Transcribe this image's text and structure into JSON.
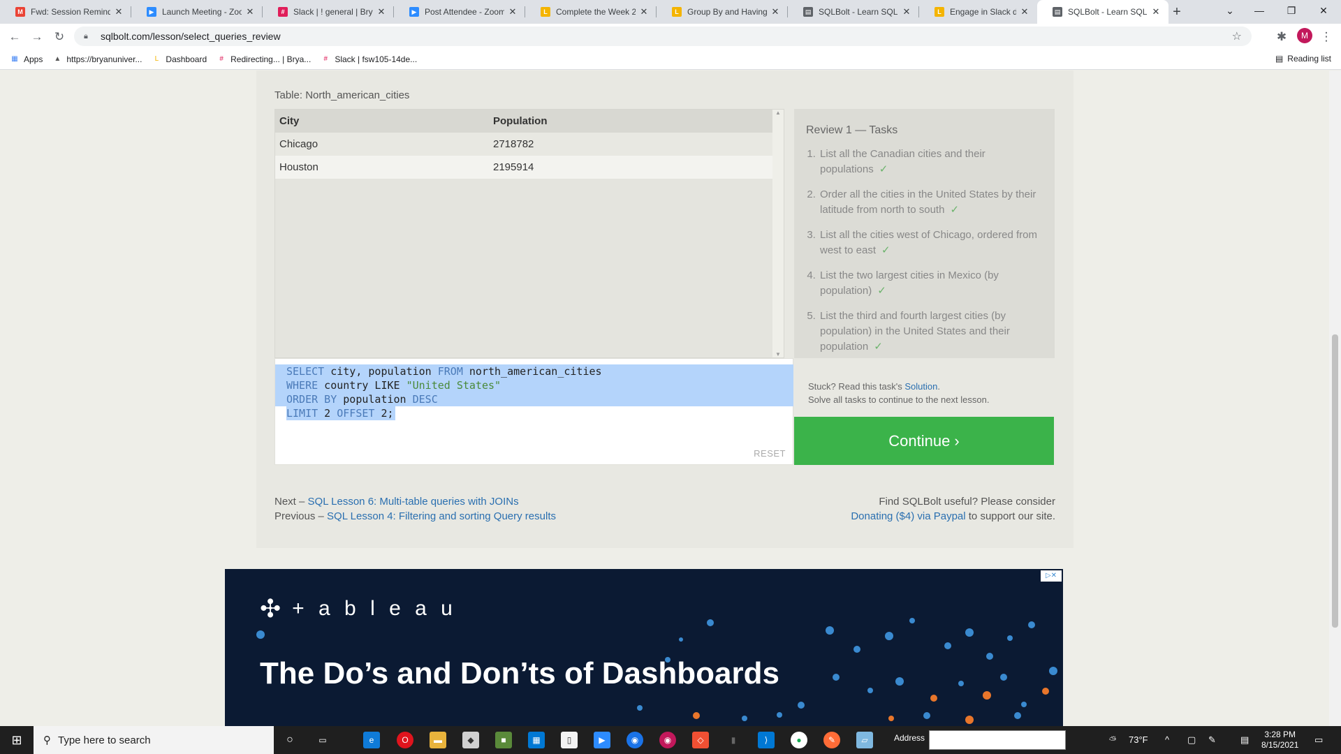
{
  "browser": {
    "tabs": [
      {
        "title": "Fwd: Session Reminde",
        "icon": "gmail-icon",
        "color": "#ea4335",
        "glyph": "M"
      },
      {
        "title": "Launch Meeting - Zoo",
        "icon": "zoom-icon",
        "color": "#2d8cff",
        "glyph": "▶"
      },
      {
        "title": "Slack | ! general | Bryan",
        "icon": "slack-icon",
        "color": "#e01e5a",
        "glyph": "#"
      },
      {
        "title": "Post Attendee - Zoom",
        "icon": "zoom-icon",
        "color": "#2d8cff",
        "glyph": "▶"
      },
      {
        "title": "Complete the Week 2",
        "icon": "doc-icon",
        "color": "#f4b400",
        "glyph": "L"
      },
      {
        "title": "Group By and Having",
        "icon": "doc-icon",
        "color": "#f4b400",
        "glyph": "L"
      },
      {
        "title": "SQLBolt - Learn SQL -",
        "icon": "sqlbolt-icon",
        "color": "#5f6368",
        "glyph": "▤"
      },
      {
        "title": "Engage in Slack during",
        "icon": "doc-icon",
        "color": "#f4b400",
        "glyph": "L"
      },
      {
        "title": "SQLBolt - Learn SQL -",
        "icon": "sqlbolt-icon",
        "color": "#5f6368",
        "glyph": "▤"
      }
    ],
    "url": "sqlbolt.com/lesson/select_queries_review",
    "bookmarks": [
      {
        "label": "Apps",
        "icon": "apps-grid-icon"
      },
      {
        "label": "https://bryanuniver...",
        "icon": "page-icon"
      },
      {
        "label": "Dashboard",
        "icon": "doc-icon"
      },
      {
        "label": "Redirecting... | Brya...",
        "icon": "slack-icon"
      },
      {
        "label": "Slack | fsw105-14de...",
        "icon": "slack-icon"
      }
    ],
    "reading_list": "Reading list",
    "avatar_letter": "M"
  },
  "lesson": {
    "table_label": "Table: North_american_cities",
    "columns": [
      "City",
      "Population"
    ],
    "rows": [
      [
        "Chicago",
        "2718782"
      ],
      [
        "Houston",
        "2195914"
      ]
    ],
    "query": {
      "line1": {
        "kw1": "SELECT",
        "t1": " city, population ",
        "kw2": "FROM",
        "t2": " north_american_cities"
      },
      "line2": {
        "kw1": "WHERE",
        "t1": " country LIKE ",
        "str": "\"United States\""
      },
      "line3": {
        "kw1": "ORDER BY",
        "t1": " population ",
        "kw2": "DESC"
      },
      "line4": {
        "kw1": "LIMIT",
        "t1": " 2 ",
        "kw2": "OFFSET",
        "t2": " 2;"
      }
    },
    "reset_label": "RESET",
    "tasks_title": "Review 1 — Tasks",
    "tasks": [
      "List all the Canadian cities and their populations",
      "Order all the cities in the United States by their latitude from north to south",
      "List all the cities west of Chicago, ordered from west to east",
      "List the two largest cities in Mexico (by population)",
      "List the third and fourth largest cities (by population) in the United States and their population"
    ],
    "check_mark": "✓",
    "stuck_prefix": "Stuck? Read this task's ",
    "solution_link": "Solution",
    "stuck_suffix": ".",
    "solve_all": "Solve all tasks to continue to the next lesson.",
    "continue_label": "Continue ›",
    "next_prefix": "Next – ",
    "next_link": "SQL Lesson 6: Multi-table queries with JOINs",
    "prev_prefix": "Previous – ",
    "prev_link": "SQL Lesson 4: Filtering and sorting Query results",
    "useful_text": "Find SQLBolt useful? Please consider",
    "donate_link": "Donating ($4) via Paypal",
    "donate_suffix": " to support our site."
  },
  "ad": {
    "brand": "+ a b l e a u",
    "headline": "The Do’s and Don’ts of Dashboards"
  },
  "taskbar": {
    "search_placeholder": "Type here to search",
    "address_label": "Address",
    "weather": "73°F",
    "time": "3:28 PM",
    "date": "8/15/2021"
  }
}
